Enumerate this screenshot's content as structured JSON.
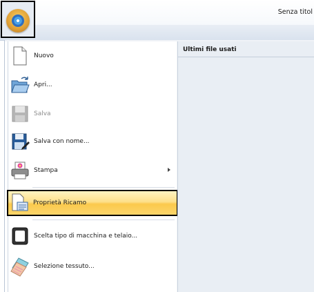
{
  "window": {
    "title": "Senza titol"
  },
  "menu": {
    "items": [
      {
        "label": "Nuovo",
        "icon": "new-document-icon",
        "disabled": false
      },
      {
        "label": "Apri...",
        "icon": "open-folder-icon",
        "disabled": false
      },
      {
        "label": "Salva",
        "icon": "save-disk-icon",
        "disabled": true
      },
      {
        "label": "Salva con nome...",
        "icon": "save-as-icon",
        "disabled": false
      },
      {
        "label": "Stampa",
        "icon": "printer-icon",
        "disabled": false,
        "submenu": true
      },
      {
        "label": "Proprietà Ricamo",
        "icon": "embroidery-properties-icon",
        "disabled": false,
        "highlighted": true
      },
      {
        "label": "Scelta tipo di macchina e telaio...",
        "icon": "machine-hoop-icon",
        "disabled": false
      },
      {
        "label": "Selezione tessuto...",
        "icon": "fabric-select-icon",
        "disabled": false
      }
    ]
  },
  "recent": {
    "header": "Ultimi file usati"
  },
  "colors": {
    "highlight": "#fbc94d",
    "accent": "#4aa3e8"
  }
}
